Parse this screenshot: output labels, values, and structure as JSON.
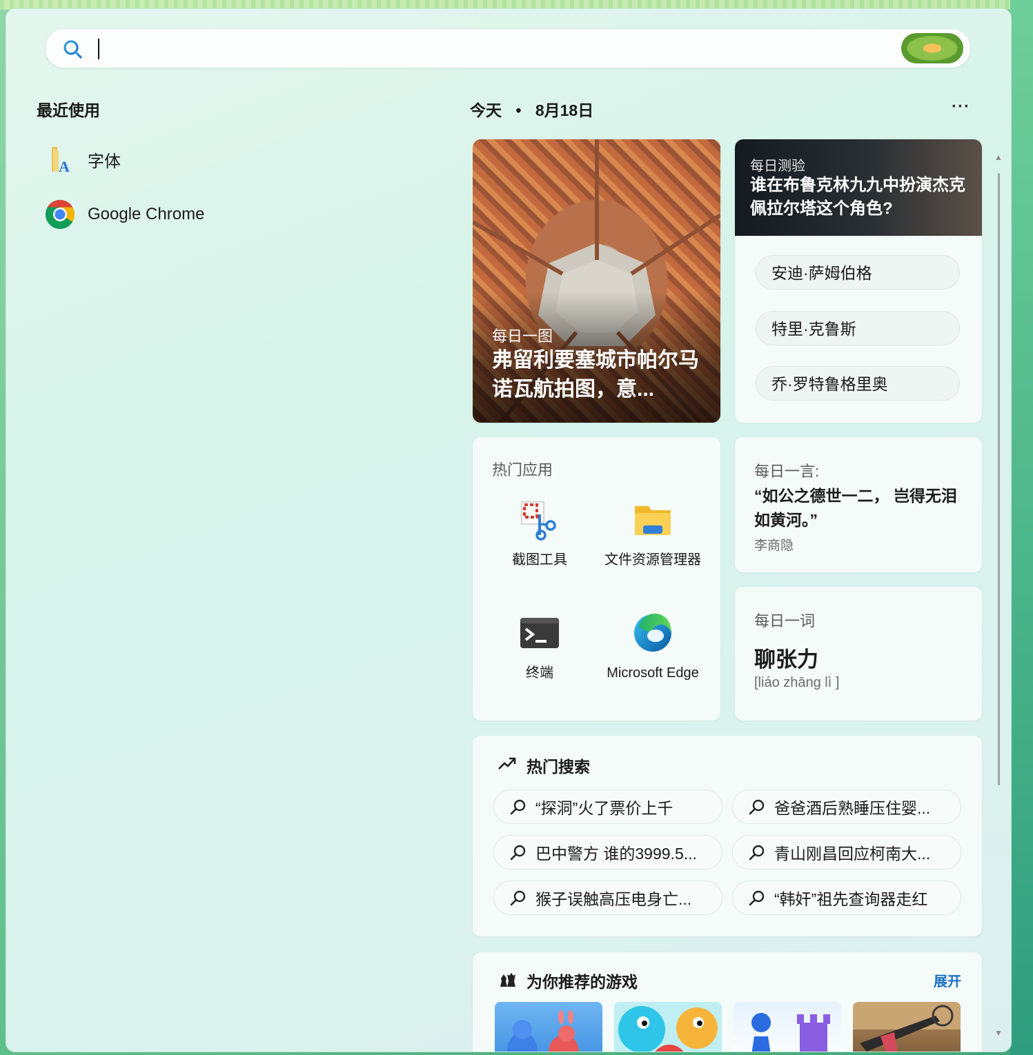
{
  "search": {
    "placeholder": ""
  },
  "recent": {
    "title": "最近使用",
    "items": [
      {
        "label": "字体",
        "icon": "fonts-folder-icon"
      },
      {
        "label": "Google Chrome",
        "icon": "chrome-icon"
      }
    ]
  },
  "today": {
    "prefix": "今天",
    "separator": "•",
    "date": "8月18日",
    "more": "···"
  },
  "photo": {
    "tag": "每日一图",
    "title": "弗留利要塞城市帕尔马诺瓦航拍图，意..."
  },
  "quiz": {
    "tag": "每日测验",
    "question": "谁在布鲁克林九九中扮演杰克佩拉尔塔这个角色?",
    "options": [
      "安迪·萨姆伯格",
      "特里·克鲁斯",
      "乔·罗特鲁格里奥"
    ]
  },
  "apps": {
    "title": "热门应用",
    "items": [
      {
        "name": "截图工具",
        "icon": "snipping-tool-icon"
      },
      {
        "name": "文件资源管理器",
        "icon": "file-explorer-icon"
      },
      {
        "name": "终端",
        "icon": "terminal-icon"
      },
      {
        "name": "Microsoft Edge",
        "icon": "edge-icon"
      }
    ]
  },
  "quote": {
    "title": "每日一言:",
    "text": "“如公之德世一二， 岂得无泪如黄河。”",
    "author": "李商隐"
  },
  "word": {
    "title": "每日一词",
    "word": "聊张力",
    "pinyin": "[liáo zhāng lì ]"
  },
  "hot": {
    "title": "热门搜索",
    "items": [
      "“探洞”火了票价上千",
      "爸爸酒后熟睡压住婴...",
      "巴中警方 谁的3999.5...",
      "青山刚昌回应柯南大...",
      "猴子误触高压电身亡...",
      "“韩奸”祖先查询器走红"
    ]
  },
  "games": {
    "title": "为你推荐的游戏",
    "expand": "展开"
  },
  "colors": {
    "accent": "#1a6fc4",
    "panel": "#e3f6ee",
    "text": "#1b1b1b"
  }
}
